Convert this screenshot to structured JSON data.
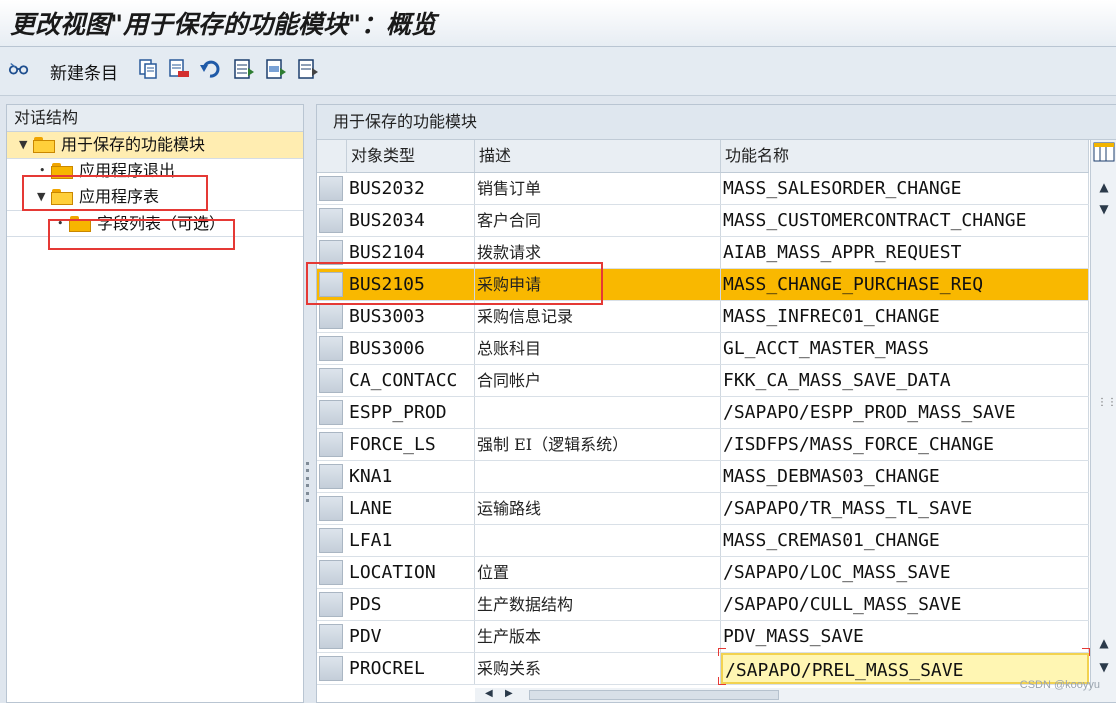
{
  "window": {
    "title": "更改视图\"用于保存的功能模块\"：概览"
  },
  "toolbar": {
    "new_entries_label": "新建条目",
    "icons": [
      "glasses-icon",
      "copy-icon",
      "delete-icon",
      "undo-icon",
      "select-all-icon",
      "select-block-icon",
      "deselect-icon"
    ]
  },
  "dialog_structure": {
    "title": "对话结构",
    "items": [
      {
        "label": "用于保存的功能模块",
        "level": 0,
        "expanded": true,
        "selected": true
      },
      {
        "label": "应用程序退出",
        "level": 1,
        "expanded": false,
        "selected": false
      },
      {
        "label": "应用程序表",
        "level": 1,
        "expanded": true,
        "selected": false
      },
      {
        "label": "字段列表（可选）",
        "level": 2,
        "expanded": false,
        "selected": false
      }
    ]
  },
  "table": {
    "title": "用于保存的功能模块",
    "columns": [
      "对象类型",
      "描述",
      "功能名称"
    ],
    "rows": [
      {
        "type": "BUS2032",
        "desc": "销售订单",
        "func": "MASS_SALESORDER_CHANGE"
      },
      {
        "type": "BUS2034",
        "desc": "客户合同",
        "func": "MASS_CUSTOMERCONTRACT_CHANGE"
      },
      {
        "type": "BUS2104",
        "desc": "拨款请求",
        "func": "AIAB_MASS_APPR_REQUEST"
      },
      {
        "type": "BUS2105",
        "desc": "采购申请",
        "func": "MASS_CHANGE_PURCHASE_REQ"
      },
      {
        "type": "BUS3003",
        "desc": "采购信息记录",
        "func": "MASS_INFREC01_CHANGE"
      },
      {
        "type": "BUS3006",
        "desc": "总账科目",
        "func": "GL_ACCT_MASTER_MASS"
      },
      {
        "type": "CA_CONTACC",
        "desc": "合同帐户",
        "func": "FKK_CA_MASS_SAVE_DATA"
      },
      {
        "type": "ESPP_PROD",
        "desc": "",
        "func": "/SAPAPO/ESPP_PROD_MASS_SAVE"
      },
      {
        "type": "FORCE_LS",
        "desc": "强制 EI（逻辑系统）",
        "func": "/ISDFPS/MASS_FORCE_CHANGE"
      },
      {
        "type": "KNA1",
        "desc": "",
        "func": "MASS_DEBMAS03_CHANGE"
      },
      {
        "type": "LANE",
        "desc": "运输路线",
        "func": "/SAPAPO/TR_MASS_TL_SAVE"
      },
      {
        "type": "LFA1",
        "desc": "",
        "func": "MASS_CREMAS01_CHANGE"
      },
      {
        "type": "LOCATION",
        "desc": "位置",
        "func": "/SAPAPO/LOC_MASS_SAVE"
      },
      {
        "type": "PDS",
        "desc": "生产数据结构",
        "func": "/SAPAPO/CULL_MASS_SAVE"
      },
      {
        "type": "PDV",
        "desc": "生产版本",
        "func": "PDV_MASS_SAVE"
      },
      {
        "type": "PROCREL",
        "desc": "采购关系",
        "func": "/SAPAPO/PREL_MASS_SAVE"
      }
    ],
    "selected_row": 3,
    "editing_row": 15
  },
  "footer": {
    "watermark": "CSDN @kooyyu"
  },
  "colors": {
    "selected_row": "#f9b800",
    "tree_selected": "#ffedb1",
    "highlight_box": "#e53935"
  }
}
